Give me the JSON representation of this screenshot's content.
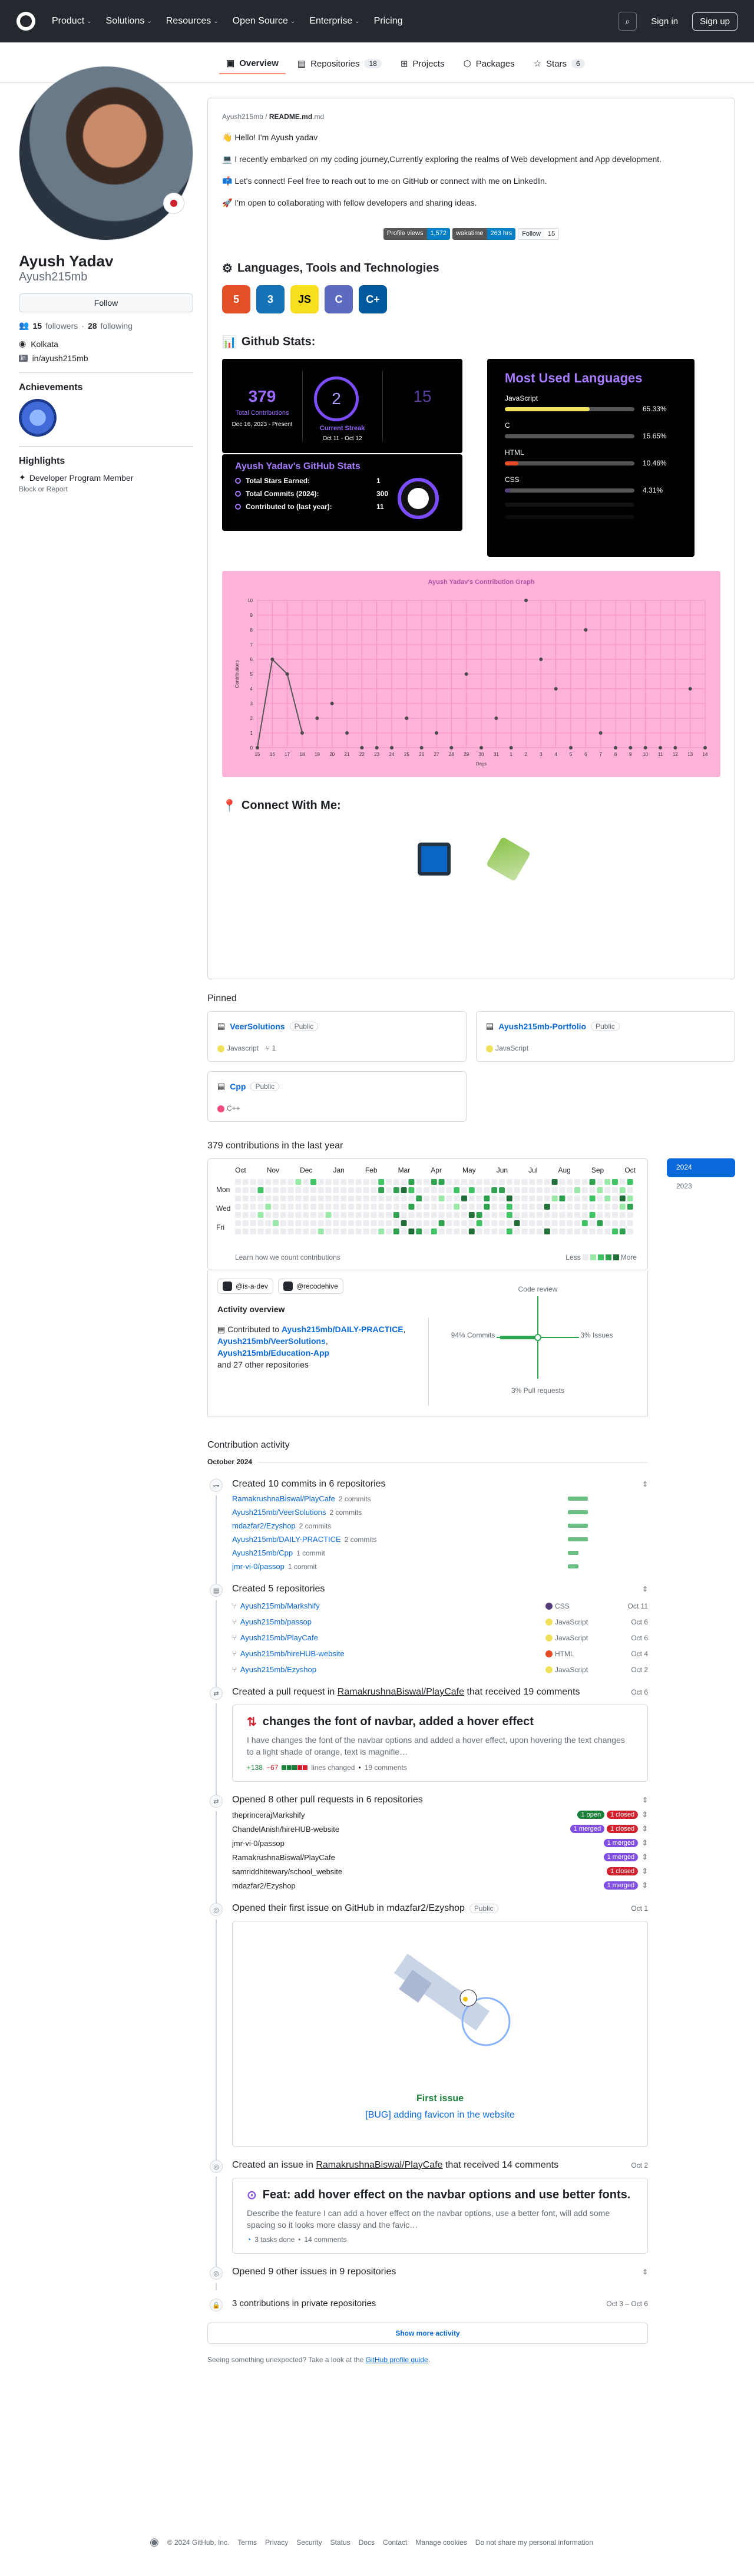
{
  "nav": {
    "items": [
      "Product",
      "Solutions",
      "Resources",
      "Open Source",
      "Enterprise",
      "Pricing"
    ],
    "signin": "Sign in",
    "signup": "Sign up"
  },
  "tabs": [
    {
      "label": "Overview"
    },
    {
      "label": "Repositories",
      "count": "18"
    },
    {
      "label": "Projects"
    },
    {
      "label": "Packages"
    },
    {
      "label": "Stars",
      "count": "6"
    }
  ],
  "profile": {
    "name": "Ayush Yadav",
    "login": "Ayush215mb",
    "follow": "Follow",
    "followers": "15",
    "followers_label": "followers",
    "following": "28",
    "following_label": "following",
    "location": "Kolkata",
    "linkedin": "in/ayush215mb",
    "achievements": "Achievements",
    "highlights": "Highlights",
    "highlight_item": "Developer Program Member",
    "block": "Block or Report"
  },
  "readme": {
    "path_owner": "Ayush215mb",
    "path_file": "README.md",
    "lines": [
      "👋 Hello! I'm Ayush yadav",
      "💻 I recently embarked on my coding journey,Currently exploring the realms of Web development and App development.",
      "📫 Let's connect! Feel free to reach out to me on GitHub or connect with me on LinkedIn.",
      "🚀 I'm open to collaborating with fellow developers and sharing ideas."
    ],
    "badges": [
      {
        "l": "Profile views",
        "r": "1,572",
        "c": "#007ec6"
      },
      {
        "l": "wakatime",
        "r": "263 hrs",
        "c": "#007ec6"
      }
    ],
    "follow_badge": "Follow",
    "follow_count": "15",
    "tools_h": "Languages, Tools and Technologies",
    "stats_h": "Github Stats:",
    "connect_h": "Connect With Me:",
    "techs": [
      {
        "t": "5",
        "c": "#e34f26"
      },
      {
        "t": "3",
        "c": "#1572b6"
      },
      {
        "t": "JS",
        "c": "#f7df1e"
      },
      {
        "t": "C",
        "c": "#5c6bc0"
      },
      {
        "t": "C+",
        "c": "#00599c"
      }
    ]
  },
  "streak": {
    "total": "379",
    "total_label": "Total Contributions",
    "range": "Dec 16, 2023 - Present",
    "current": "2",
    "current_label": "Current Streak",
    "current_range": "Oct 11 - Oct 12",
    "longest": "15"
  },
  "ghstats": {
    "title": "Ayush Yadav's GitHub Stats",
    "rows": [
      {
        "k": "Total Stars Earned:",
        "v": "1"
      },
      {
        "k": "Total Commits (2024):",
        "v": "300"
      },
      {
        "k": "Contributed to (last year):",
        "v": "11"
      }
    ]
  },
  "langs": {
    "title": "Most Used Languages",
    "items": [
      {
        "name": "JavaScript",
        "pct": "65.33%",
        "v": 65.33,
        "c": "#f1e05a"
      },
      {
        "name": "C",
        "pct": "15.65%",
        "v": 15.65,
        "c": "#555555"
      },
      {
        "name": "HTML",
        "pct": "10.46%",
        "v": 10.46,
        "c": "#e34c26"
      },
      {
        "name": "CSS",
        "pct": "4.31%",
        "v": 4.31,
        "c": "#563d7c"
      }
    ]
  },
  "chart_data": {
    "type": "line",
    "title": "Ayush Yadav's Contribution Graph",
    "xlabel": "Days",
    "ylabel": "Contributions",
    "ylim": [
      0,
      10
    ],
    "x": [
      "15",
      "16",
      "17",
      "18",
      "19",
      "20",
      "21",
      "22",
      "23",
      "24",
      "25",
      "26",
      "27",
      "28",
      "29",
      "30",
      "31",
      "1",
      "2",
      "3",
      "4",
      "5",
      "6",
      "7",
      "8",
      "9",
      "10",
      "11",
      "12",
      "13",
      "14"
    ],
    "values": [
      0,
      6,
      5,
      1,
      2,
      3,
      1,
      0,
      0,
      0,
      2,
      0,
      1,
      0,
      5,
      0,
      2,
      0,
      10,
      6,
      4,
      0,
      8,
      1,
      0,
      0,
      0,
      0,
      0,
      4,
      0
    ]
  },
  "pinned": {
    "title": "Pinned",
    "items": [
      {
        "name": "VeerSolutions",
        "vis": "Public",
        "lang": "Javascript",
        "lc": "#f1e05a",
        "forks": "1"
      },
      {
        "name": "Ayush215mb-Portfolio",
        "vis": "Public",
        "lang": "JavaScript",
        "lc": "#f1e05a"
      },
      {
        "name": "Cpp",
        "vis": "Public",
        "lang": "C++",
        "lc": "#f34b7d"
      }
    ]
  },
  "contrib": {
    "title": "379 contributions in the last year",
    "months": [
      "Oct",
      "Nov",
      "Dec",
      "Jan",
      "Feb",
      "Mar",
      "Apr",
      "May",
      "Jun",
      "Jul",
      "Aug",
      "Sep",
      "Oct"
    ],
    "days": [
      "Mon",
      "Wed",
      "Fri"
    ],
    "learn": "Learn how we count contributions",
    "less": "Less",
    "more": "More",
    "years": [
      "2024",
      "2023"
    ],
    "orgs": [
      "@is-a-dev",
      "@recodehive"
    ],
    "overview": "Activity overview",
    "contributed": "Contributed to",
    "repos": [
      "Ayush215mb/DAILY-PRACTICE",
      "Ayush215mb/VeerSolutions",
      "Ayush215mb/Education-App"
    ],
    "others": "and 27 other repositories",
    "radar": {
      "review": "Code review",
      "commits": "94% Commits",
      "issues": "3% Issues",
      "prs": "3% Pull requests"
    }
  },
  "activity": {
    "title": "Contribution activity",
    "month": "October 2024",
    "commits": {
      "title": "Created 10 commits in 6 repositories",
      "rows": [
        {
          "r": "RamakrushnaBiswal/PlayCafe",
          "n": "2 commits",
          "w": 34
        },
        {
          "r": "Ayush215mb/VeerSolutions",
          "n": "2 commits",
          "w": 34
        },
        {
          "r": "mdazfar2/Ezyshop",
          "n": "2 commits",
          "w": 34
        },
        {
          "r": "Ayush215mb/DAILY-PRACTICE",
          "n": "2 commits",
          "w": 34
        },
        {
          "r": "Ayush215mb/Cpp",
          "n": "1 commit",
          "w": 18
        },
        {
          "r": "jmr-vi-0/passop",
          "n": "1 commit",
          "w": 18
        }
      ]
    },
    "repos": {
      "title": "Created 5 repositories",
      "rows": [
        {
          "r": "Ayush215mb/Markshify",
          "l": "CSS",
          "c": "#563d7c",
          "d": "Oct 11"
        },
        {
          "r": "Ayush215mb/passop",
          "l": "JavaScript",
          "c": "#f1e05a",
          "d": "Oct 6"
        },
        {
          "r": "Ayush215mb/PlayCafe",
          "l": "JavaScript",
          "c": "#f1e05a",
          "d": "Oct 6"
        },
        {
          "r": "Ayush215mb/hireHUB-website",
          "l": "HTML",
          "c": "#e34c26",
          "d": "Oct 4"
        },
        {
          "r": "Ayush215mb/Ezyshop",
          "l": "JavaScript",
          "c": "#f1e05a",
          "d": "Oct 2"
        }
      ]
    },
    "pr": {
      "title_pre": "Created a pull request in",
      "repo": "RamakrushnaBiswal/PlayCafe",
      "title_post": "that received 19 comments",
      "date": "Oct 6",
      "card_title": "changes the font of navbar, added a hover effect",
      "card_desc": "I have changes the font of the navbar options and added a hover effect, upon hovering the text changes to a light shade of orange, text is magnifie…",
      "add": "+138",
      "del": "−67",
      "lines": "lines changed",
      "comments": "19 comments"
    },
    "prs": {
      "title": "Opened 8 other pull requests in 6 repositories",
      "rows": [
        {
          "r": "theprincerajMarkshify",
          "s": [
            {
              "t": "1 open",
              "c": "#1a7f37"
            },
            {
              "t": "1 closed",
              "c": "#cf222e"
            }
          ]
        },
        {
          "r": "ChandelAnish/hireHUB-website",
          "s": [
            {
              "t": "1 merged",
              "c": "#8250df"
            },
            {
              "t": "1 closed",
              "c": "#cf222e"
            }
          ]
        },
        {
          "r": "jmr-vi-0/passop",
          "s": [
            {
              "t": "1 merged",
              "c": "#8250df"
            }
          ]
        },
        {
          "r": "RamakrushnaBiswal/PlayCafe",
          "s": [
            {
              "t": "1 merged",
              "c": "#8250df"
            }
          ]
        },
        {
          "r": "samriddhitewary/school_website",
          "s": [
            {
              "t": "1 closed",
              "c": "#cf222e"
            }
          ]
        },
        {
          "r": "mdazfar2/Ezyshop",
          "s": [
            {
              "t": "1 merged",
              "c": "#8250df"
            }
          ]
        }
      ]
    },
    "first": {
      "title": "Opened their first issue on GitHub in mdazfar2/Ezyshop",
      "vis": "Public",
      "date": "Oct 1",
      "label": "First issue",
      "link": "[BUG] adding favicon in the website"
    },
    "issue": {
      "title_pre": "Created an issue in",
      "repo": "RamakrushnaBiswal/PlayCafe",
      "title_post": "that received 14 comments",
      "date": "Oct 2",
      "card_title": "Feat: add hover effect on the navbar options and use better fonts.",
      "card_desc": "Describe the feature I can add a hover effect on the navbar options, use a better font, will add some spacing so it looks more classy and the favic…",
      "tasks": "3 tasks done",
      "comments": "14 comments"
    },
    "other_issues": "Opened 9 other issues in 9 repositories",
    "private": "3 contributions in private repositories",
    "private_date": "Oct 3 – Oct 6",
    "show_more": "Show more activity",
    "unexpected": "Seeing something unexpected? Take a look at the",
    "guide": "GitHub profile guide"
  },
  "footer": [
    "© 2024 GitHub, Inc.",
    "Terms",
    "Privacy",
    "Security",
    "Status",
    "Docs",
    "Contact",
    "Manage cookies",
    "Do not share my personal information"
  ]
}
